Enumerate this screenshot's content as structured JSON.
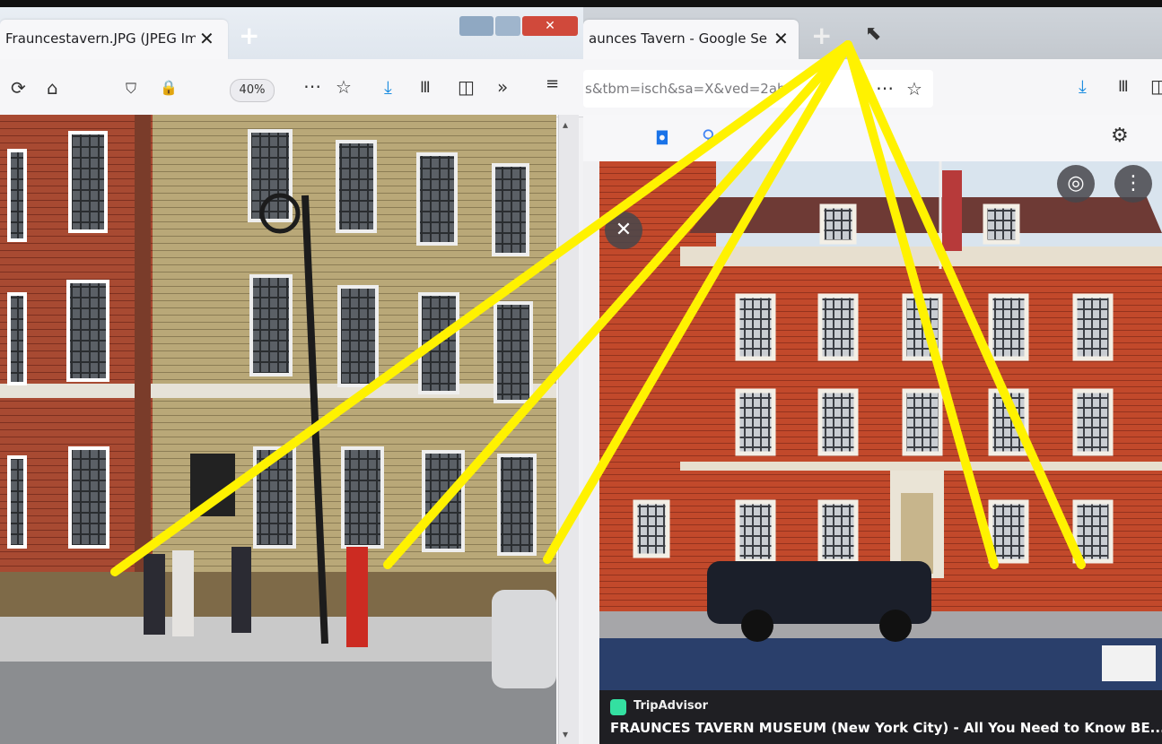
{
  "left_window": {
    "tab_title": "Frauncestavern.JPG (JPEG Imag",
    "zoom_level": "40%",
    "window_controls": [
      "minimize",
      "maximize",
      "close"
    ],
    "toolbar_icons": [
      "reload-icon",
      "home-icon",
      "shield-icon",
      "lock-icon",
      "more-icon",
      "star-icon",
      "download-icon",
      "library-icon",
      "sidebar-icon",
      "overflow-icon",
      "extension-icon"
    ]
  },
  "right_window": {
    "tab_title": "aunces Tavern - Google Sear",
    "url_fragment": "s&tbm=isch&sa=X&ved=2ah",
    "source_name": "TripAdvisor",
    "result_title": "FRAUNCES TAVERN MUSEUM (New York City) - All You Need to Know BE..."
  },
  "colors": {
    "annotation_yellow": "#fff200",
    "brick": "#a8432a",
    "sky": "#d9e4ee",
    "tripadvisor_green": "#34e0a1"
  }
}
